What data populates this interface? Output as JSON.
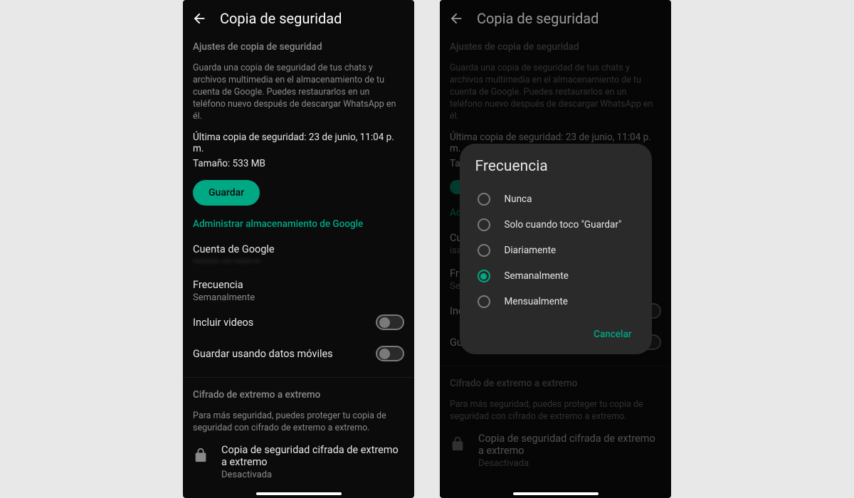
{
  "left": {
    "header_title": "Copia de seguridad",
    "section_label": "Ajustes de copia de seguridad",
    "desc": "Guarda una copia de seguridad de tus chats y archivos multimedia en el almacenamiento de tu cuenta de Google. Puedes restaurarlos en un teléfono nuevo después de descargar WhatsApp en él.",
    "last_backup": "Última copia de seguridad: 23 de junio, 11:04 p. m.",
    "size": "Tamaño: 533 MB",
    "save_button": "Guardar",
    "manage_storage": "Administrar almacenamiento de Google",
    "google_account_label": "Cuenta de Google",
    "google_account_value": "••••••••  •••  •••••  ••",
    "frequency_label": "Frecuencia",
    "frequency_value": "Semanalmente",
    "include_videos_label": "Incluir videos",
    "mobile_data_label": "Guardar usando datos móviles",
    "e2e_section": "Cifrado de extremo a extremo",
    "e2e_desc": "Para más seguridad, puedes proteger tu copia de seguridad con cifrado de extremo a extremo.",
    "e2e_title": "Copia de seguridad cifrada de extremo a extremo",
    "e2e_status": "Desactivada"
  },
  "right": {
    "header_title": "Copia de seguridad",
    "section_label": "Ajustes de copia de seguridad",
    "desc": "Guarda una copia de seguridad de tus chats y archivos multimedia en el almacenamiento de tu cuenta de Google. Puedes restaurarlos en un teléfono nuevo después de descargar WhatsApp en él.",
    "last_backup": "Última copia de seguridad: 23 de junio, 11:04 p. m.",
    "size": "Tamaño: 533 MB",
    "google_account_label": "Cu",
    "google_account_prefix": "isa",
    "manage_storage_short": "Ad",
    "frequency_label_short": "Fr",
    "frequency_value_short": "Se",
    "include_videos_short": "Inc",
    "mobile_data_short": "Gu",
    "e2e_section": "Cifrado de extremo a extremo",
    "e2e_desc": "Para más seguridad, puedes proteger tu copia de seguridad con cifrado de extremo a extremo.",
    "e2e_title": "Copia de seguridad cifrada de extremo a extremo",
    "e2e_status": "Desactivada",
    "dialog": {
      "title": "Frecuencia",
      "options": [
        "Nunca",
        "Solo cuando toco \"Guardar\"",
        "Diariamente",
        "Semanalmente",
        "Mensualmente"
      ],
      "selected_index": 3,
      "cancel": "Cancelar"
    }
  }
}
